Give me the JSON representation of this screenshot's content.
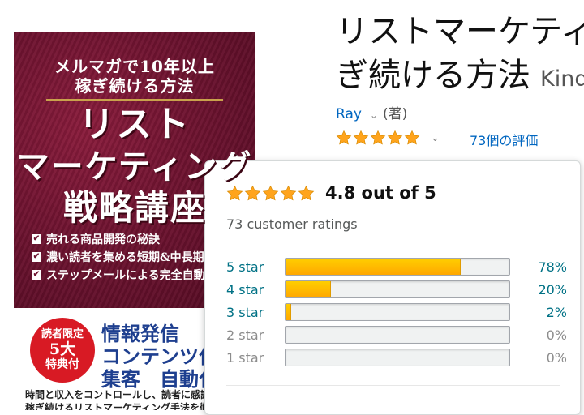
{
  "cover": {
    "subtitle_line1": "メルマガで10年以上",
    "subtitle_line2": "稼ぎ続ける方法",
    "title_line1": "リスト",
    "title_line2": "マーケティング",
    "title_line3": "戦略講座",
    "bullets": [
      "売れる商品開発の秘訣",
      "濃い読者を集める短期&中長期",
      "ステップメールによる完全自動化"
    ],
    "badge": {
      "line1": "読者限定",
      "line2": "5大",
      "line3": "特典付"
    },
    "features": [
      "情報発信",
      "コンテンツ作",
      "集客　自動化"
    ],
    "footer_line1": "時間と収入をコントロールし、読者に感謝さ",
    "footer_line2": "稼ぎ続けるリストマーケティング手法を徹"
  },
  "product": {
    "title_line1": "リストマーケティ",
    "title_line2": "ぎ続ける方法",
    "format": "Kind",
    "author": "Ray",
    "author_role": "(著)",
    "ratings_link": "73個の評価"
  },
  "popover": {
    "average": "4.8 out of 5",
    "total_ratings": "73 customer ratings",
    "histogram": [
      {
        "label": "5 star",
        "percent": 78,
        "percent_text": "78%",
        "active": true
      },
      {
        "label": "4 star",
        "percent": 20,
        "percent_text": "20%",
        "active": true
      },
      {
        "label": "3 star",
        "percent": 2,
        "percent_text": "2%",
        "active": true
      },
      {
        "label": "2 star",
        "percent": 0,
        "percent_text": "0%",
        "active": false
      },
      {
        "label": "1 star",
        "percent": 0,
        "percent_text": "0%",
        "active": false
      }
    ]
  },
  "colors": {
    "link": "#0066c0",
    "star": "#ffa41c",
    "bar_fill": "#ffa700",
    "cover_bg": "#6e1330"
  }
}
